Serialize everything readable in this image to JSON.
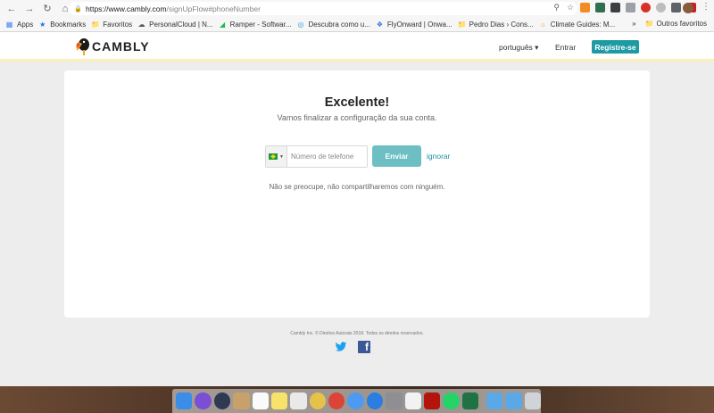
{
  "browser": {
    "url_host": "https://www.cambly.com",
    "url_path": "/signUpFlow#phoneNumber",
    "bookmarks": [
      {
        "label": "Apps",
        "icon": "apps-grid-icon",
        "color": "#4285f4"
      },
      {
        "label": "Bookmarks",
        "icon": "star-icon",
        "color": "#1a73e8"
      },
      {
        "label": "Favoritos",
        "icon": "folder-icon",
        "color": "#5f6368"
      },
      {
        "label": "PersonalCloud | N...",
        "icon": "cloud-icon",
        "color": "#555"
      },
      {
        "label": "Ramper - Softwar...",
        "icon": "ramper-icon",
        "color": "#1db954"
      },
      {
        "label": "Descubra como u...",
        "icon": "globe-icon",
        "color": "#3aa0d8"
      },
      {
        "label": "FlyOnward | Onwa...",
        "icon": "flyonward-icon",
        "color": "#2d6fd6"
      },
      {
        "label": "Pedro Dias › Cons...",
        "icon": "folder-icon",
        "color": "#5f6368"
      },
      {
        "label": "Climate Guides: M...",
        "icon": "climate-icon",
        "color": "#f0a030"
      }
    ],
    "more_bookmarks_label": "»",
    "other_bookmarks_label": "Outros favoritos"
  },
  "header": {
    "logo_text": "CAMBLY",
    "language_label": "português ▾",
    "login_label": "Entrar",
    "signup_label": "Registre-se"
  },
  "card": {
    "title": "Excelente!",
    "subtitle": "Vamos finalizar a configuração da sua conta.",
    "phone_placeholder": "Número de telefone",
    "country": "Brazil",
    "send_label": "Enviar",
    "skip_label": "ignorar",
    "privacy_note": "Não se preocupe, não compartilharemos com ninguém."
  },
  "footer": {
    "copyright": "Cambly Inc. © Direitos Autorais 2018. Todos os direitos reservados.",
    "social": [
      "twitter-icon",
      "facebook-icon"
    ]
  },
  "colors": {
    "brand_teal": "#1e9aa3",
    "send_button": "#6dbfc4",
    "header_border": "#fbefb9"
  }
}
